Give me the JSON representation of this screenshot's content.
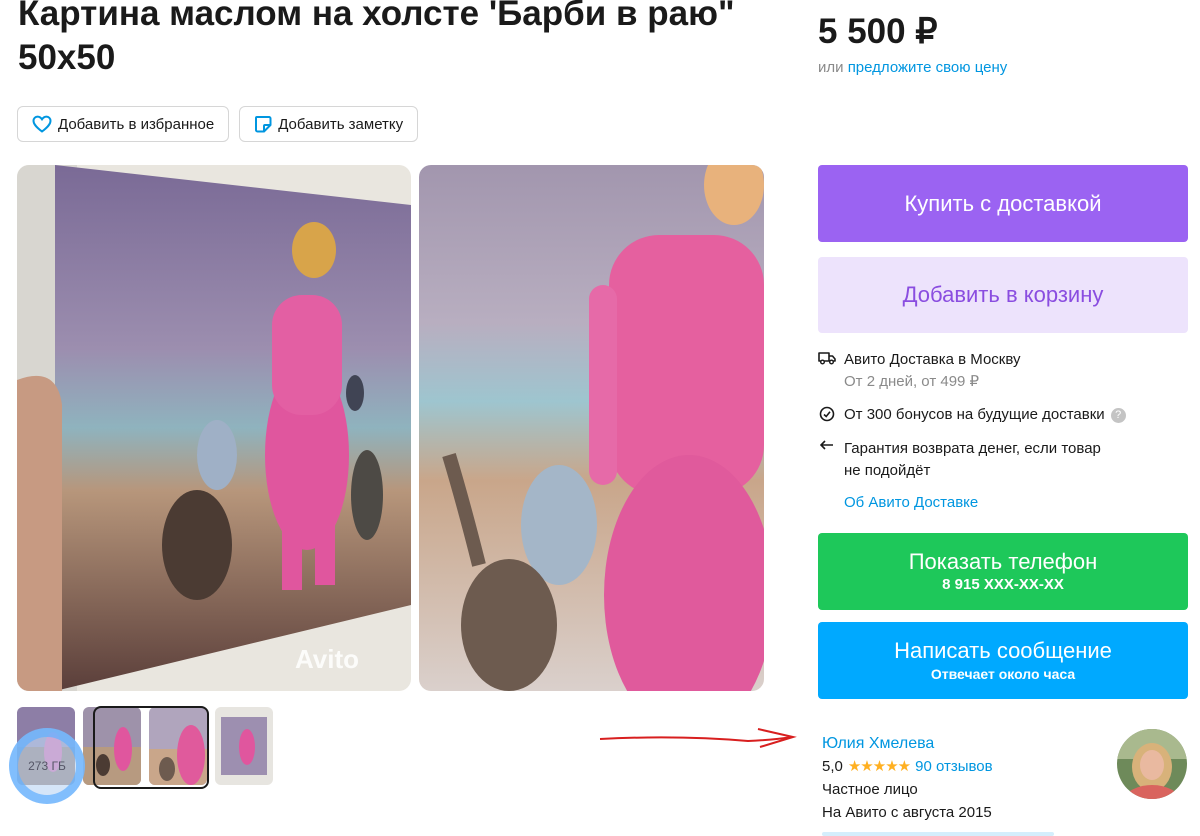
{
  "listing": {
    "title": "Картина маслом на холсте 'Барби в раю\" 50х50",
    "favorite_label": "Добавить в избранное",
    "note_label": "Добавить заметку",
    "watermark": "Avito",
    "storage_badge": "273 ГБ"
  },
  "price": {
    "amount": "5 500 ₽",
    "offer_prefix": "или",
    "offer_link": "предложите свою цену"
  },
  "buttons": {
    "buy": "Купить с доставкой",
    "cart": "Добавить в корзину",
    "phone_label": "Показать телефон",
    "phone_number": "8 915 XXX-XX-XX",
    "message_label": "Написать сообщение",
    "message_sub": "Отвечает около часа"
  },
  "delivery": {
    "city": "Авито Доставка в Москву",
    "terms": "От 2 дней, от 499 ₽",
    "bonus": "От 300 бонусов на будущие доставки",
    "guarantee_line1": "Гарантия возврата денег, если товар",
    "guarantee_line2": "не подойдёт",
    "about_link": "Об Авито Доставке"
  },
  "seller": {
    "name": "Юлия Хмелева",
    "rating": "5,0",
    "stars": "★★★★★",
    "reviews": "90 отзывов",
    "type": "Частное лицо",
    "since": "На Авито с августа 2015"
  },
  "colors": {
    "buy": "#9b63f2",
    "cart_bg": "#ede3fc",
    "phone": "#1ec85a",
    "message": "#00a9ff",
    "link": "#0096e0",
    "star": "#ffb021"
  }
}
